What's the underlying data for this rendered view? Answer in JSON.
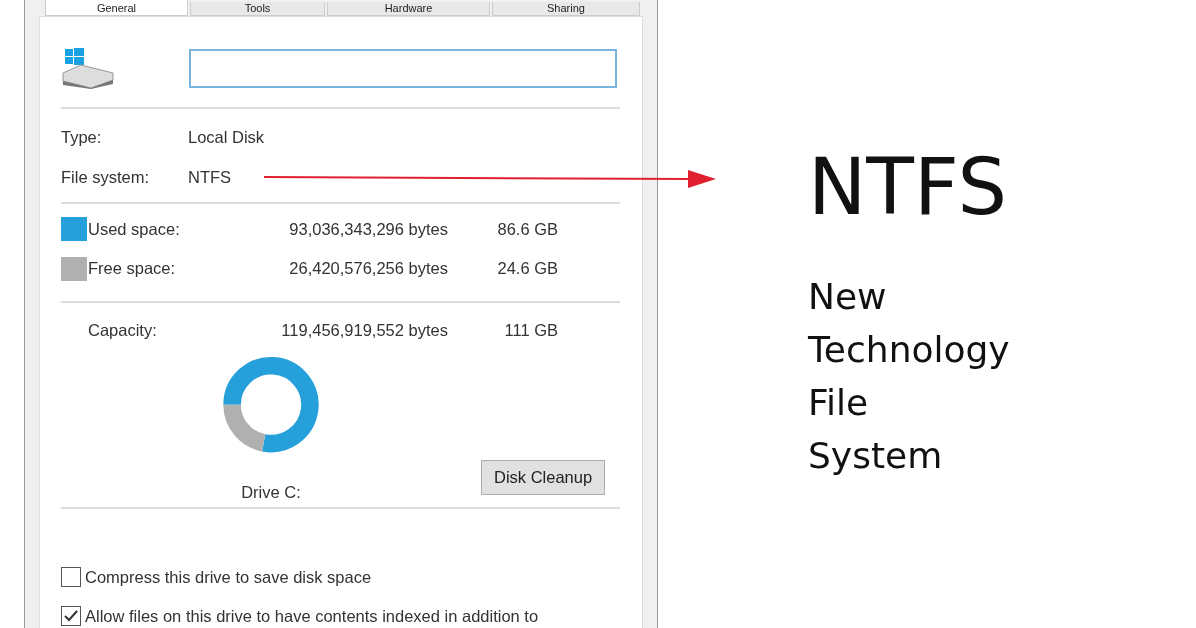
{
  "tabs": [
    {
      "label": "General",
      "selected": true
    },
    {
      "label": "Tools",
      "selected": false
    },
    {
      "label": "Hardware",
      "selected": false
    },
    {
      "label": "Sharing",
      "selected": false
    }
  ],
  "info": [
    {
      "label": "Type:",
      "value": "Local Disk"
    },
    {
      "label": "File system:",
      "value": "NTFS"
    }
  ],
  "space": [
    {
      "label": "Used space:",
      "bytes": "93,036,343,296 bytes",
      "size": "86.6 GB",
      "color": "#26a0da"
    },
    {
      "label": "Free space:",
      "bytes": "26,420,576,256 bytes",
      "size": "24.6 GB",
      "color": "#b0b0b0"
    }
  ],
  "capacity": {
    "label": "Capacity:",
    "bytes": "119,456,919,552 bytes",
    "size": "111 GB"
  },
  "drive_label": "Drive C:",
  "cleanup_button": "Disk Cleanup",
  "options": [
    {
      "label": "Compress this drive to save disk space",
      "checked": false
    },
    {
      "label": "Allow files on this drive to have contents indexed in addition to",
      "checked": true
    }
  ],
  "annotation": {
    "title": "NTFS",
    "lines": [
      "New",
      "Technology",
      "File",
      "System"
    ]
  }
}
